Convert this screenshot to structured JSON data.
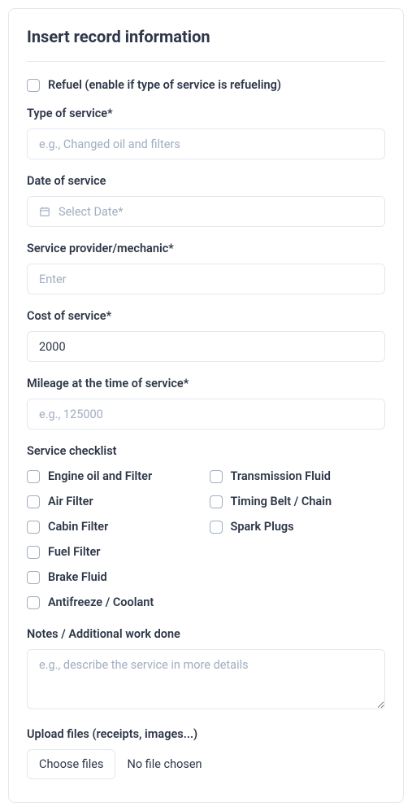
{
  "title": "Insert record information",
  "refuel": {
    "label": "Refuel (enable if type of service is refueling)"
  },
  "fields": {
    "type_of_service": {
      "label": "Type of service*",
      "placeholder": "e.g., Changed oil and filters",
      "value": ""
    },
    "date_of_service": {
      "label": "Date of service",
      "placeholder": "Select Date*",
      "value": ""
    },
    "service_provider": {
      "label": "Service provider/mechanic*",
      "placeholder": "Enter",
      "value": ""
    },
    "cost": {
      "label": "Cost of service*",
      "value": "2000"
    },
    "mileage": {
      "label": "Mileage at the time of service*",
      "placeholder": "e.g., 125000",
      "value": ""
    },
    "notes": {
      "label": "Notes / Additional work done",
      "placeholder": "e.g., describe the service in more details",
      "value": ""
    },
    "upload": {
      "label": "Upload files (receipts, images...)",
      "button": "Choose files",
      "status": "No file chosen"
    }
  },
  "checklist": {
    "label": "Service checklist",
    "items_col1": [
      "Engine oil and Filter",
      "Air Filter",
      "Cabin Filter",
      "Fuel Filter",
      "Brake Fluid",
      "Antifreeze / Coolant"
    ],
    "items_col2": [
      "Transmission Fluid",
      "Timing Belt / Chain",
      "Spark Plugs"
    ]
  }
}
